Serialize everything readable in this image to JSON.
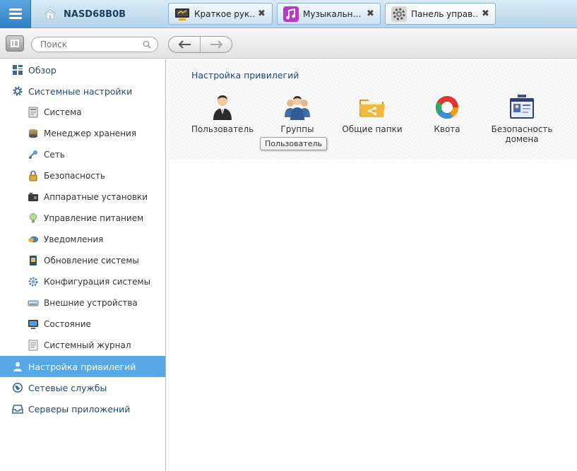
{
  "header": {
    "host_name": "NASD68B0B",
    "tabs": [
      {
        "label": "Краткое рук…",
        "icon": "monitor-icon",
        "active": false
      },
      {
        "label": "Музыкальн…",
        "icon": "music-note-icon",
        "active": false
      },
      {
        "label": "Панель управ…",
        "icon": "control-panel-gear-icon",
        "active": true
      }
    ],
    "tab_close_glyph": "✖"
  },
  "toolbar": {
    "search_placeholder": "Поиск"
  },
  "sidebar": {
    "items": [
      {
        "label": "Обзор",
        "level": "top",
        "icon": "overview-grid-icon"
      },
      {
        "label": "Системные настройки",
        "level": "top",
        "icon": "gear-icon"
      },
      {
        "label": "Система",
        "level": "sub",
        "icon": "system-icon"
      },
      {
        "label": "Менеджер хранения",
        "level": "sub",
        "icon": "storage-icon"
      },
      {
        "label": "Сеть",
        "level": "sub",
        "icon": "network-icon"
      },
      {
        "label": "Безопасность",
        "level": "sub",
        "icon": "lock-icon"
      },
      {
        "label": "Аппаратные установки",
        "level": "sub",
        "icon": "hardware-icon"
      },
      {
        "label": "Управление питанием",
        "level": "sub",
        "icon": "power-bulb-icon"
      },
      {
        "label": "Уведомления",
        "level": "sub",
        "icon": "notification-icon"
      },
      {
        "label": "Обновление системы",
        "level": "sub",
        "icon": "firmware-update-icon"
      },
      {
        "label": "Конфигурация системы",
        "level": "sub",
        "icon": "configuration-icon"
      },
      {
        "label": "Внешние устройства",
        "level": "sub",
        "icon": "external-device-icon"
      },
      {
        "label": "Состояние",
        "level": "sub",
        "icon": "status-monitor-icon"
      },
      {
        "label": "Системный журнал",
        "level": "sub",
        "icon": "system-log-icon"
      },
      {
        "label": "Настройка привилегий",
        "level": "top",
        "icon": "user-icon",
        "selected": true
      },
      {
        "label": "Сетевые службы",
        "level": "top",
        "icon": "globe-icon"
      },
      {
        "label": "Серверы приложений",
        "level": "top",
        "icon": "inbox-server-icon"
      }
    ]
  },
  "main": {
    "section_title": "Настройка привилегий",
    "items": [
      {
        "label": "Пользователь",
        "icon": "user-person-icon"
      },
      {
        "label": "Группы",
        "icon": "group-users-icon"
      },
      {
        "label": "Общие папки",
        "icon": "shared-folder-icon"
      },
      {
        "label": "Квота",
        "icon": "quota-pie-icon"
      },
      {
        "label": "Безопасность домена",
        "icon": "domain-security-icon"
      }
    ],
    "tooltip": "Пользователь"
  },
  "colors": {
    "accent": "#56a9e6",
    "link_text": "#1c4a77",
    "topbar_start": "#d9ebf7",
    "topbar_end": "#b6d4ea"
  }
}
